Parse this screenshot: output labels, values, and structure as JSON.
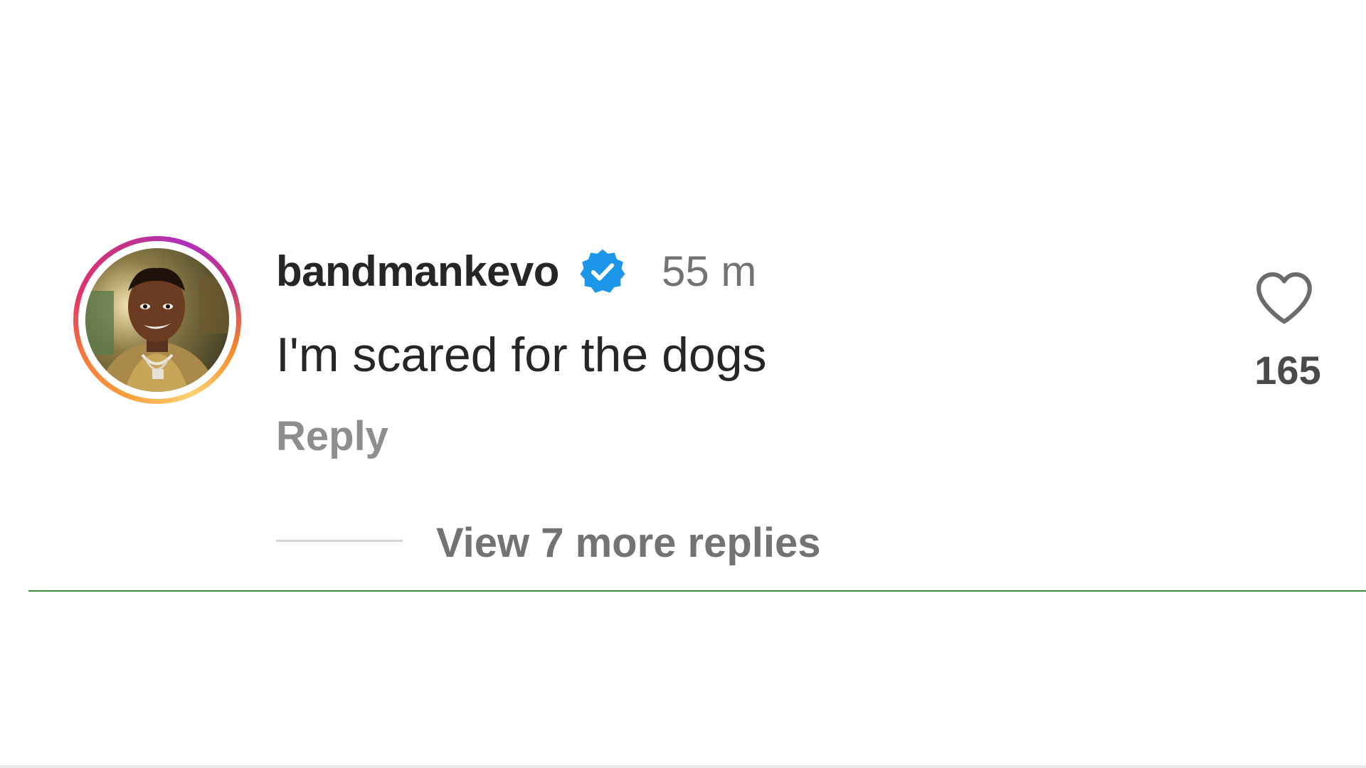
{
  "comment": {
    "username": "bandmankevo",
    "verified": true,
    "timestamp": "55 m",
    "text": "I'm scared for the dogs",
    "reply_label": "Reply",
    "like_count": "165",
    "view_replies_label": "View 7 more replies"
  },
  "icons": {
    "verified": "verified-badge-icon",
    "like": "heart-outline-icon",
    "avatar": "profile-picture"
  },
  "colors": {
    "verified_blue": "#0095f6",
    "text_primary": "#262626",
    "text_secondary": "#737373",
    "divider": "#3a8a3a"
  }
}
